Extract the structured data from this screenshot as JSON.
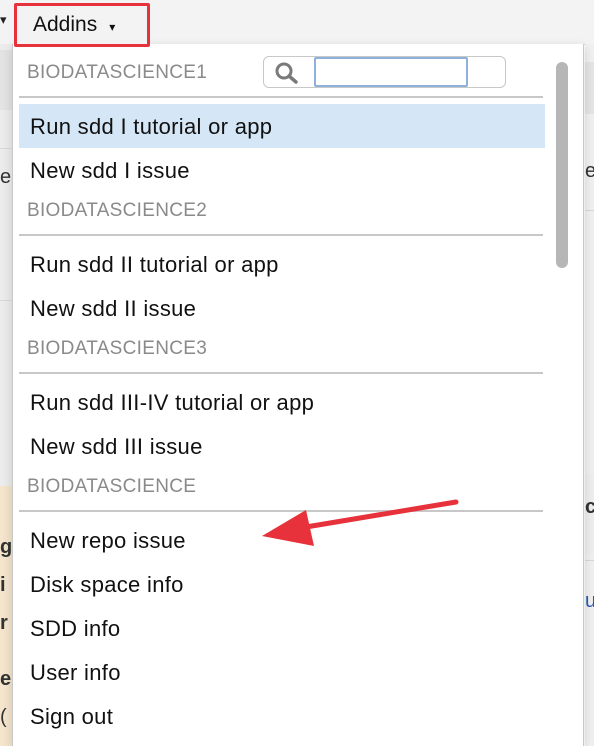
{
  "toolbar": {
    "addins_label": "Addins",
    "caret_glyph": "▾"
  },
  "dropdown": {
    "search": {
      "value": "",
      "placeholder": ""
    },
    "groups": [
      {
        "header": "BIODATASCIENCE1",
        "items": [
          "Run sdd I tutorial or app",
          "New sdd I issue"
        ]
      },
      {
        "header": "BIODATASCIENCE2",
        "items": [
          "Run sdd II tutorial or app",
          "New sdd II issue"
        ]
      },
      {
        "header": "BIODATASCIENCE3",
        "items": [
          "Run sdd III-IV tutorial or app",
          "New sdd III issue"
        ]
      },
      {
        "header": "BIODATASCIENCE",
        "items": [
          "New repo issue",
          "Disk space info",
          "SDD info",
          "User info",
          "Sign out"
        ]
      }
    ],
    "selected_item": "Run sdd I tutorial or app"
  },
  "background_fragments": {
    "left_1": "er",
    "left_2": "g",
    "left_3": "i",
    "left_4": "r",
    "left_5": "e",
    "left_6": "(",
    "right_1": "ex",
    "right_2": "ci",
    "right_3": "u"
  },
  "annotation": {
    "arrow_color": "#e8323b",
    "highlight_color": "#e8323b"
  }
}
